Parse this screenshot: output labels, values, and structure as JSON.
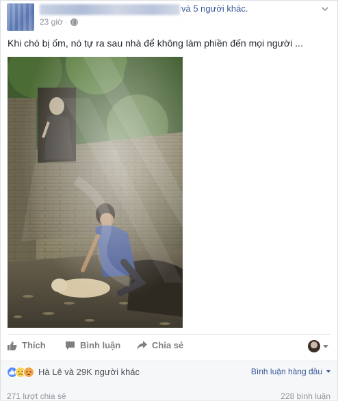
{
  "post": {
    "author_suffix": "và 5 người khác.",
    "time": "23 giờ",
    "privacy_icon": "globe-icon",
    "text": "Khi chó bị ốm, nó tự ra sau nhà để không làm phiền đến mọi người ..."
  },
  "actions": {
    "like_label": "Thích",
    "comment_label": "Bình luận",
    "share_label": "Chia sẻ"
  },
  "reactions": {
    "icons": [
      "like-react-icon",
      "sad-react-icon",
      "angry-react-icon"
    ],
    "summary": "Hà Lê và 29K người khác",
    "sort_label": "Bình luận hàng đầu",
    "shares": "271 lượt chia sẻ",
    "comments": "228 bình luận"
  },
  "colors": {
    "link": "#365899",
    "meta": "#90949c",
    "like_blue": "#5890ff"
  }
}
